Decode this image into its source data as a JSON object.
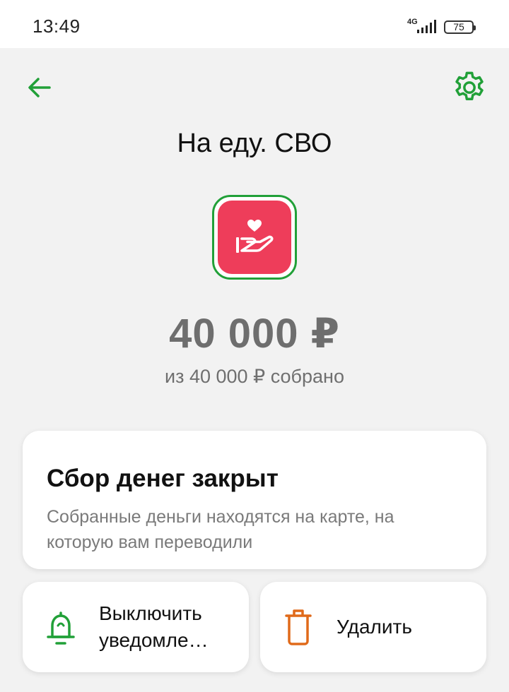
{
  "status_bar": {
    "time": "13:49",
    "network": "4G",
    "battery": "75"
  },
  "header": {
    "back_icon": "arrow-left-icon",
    "settings_icon": "gear-icon",
    "title": "На еду. СВО"
  },
  "goal": {
    "icon": "heart-in-hand-icon",
    "amount": "40 000 ₽",
    "progress_text": "из 40 000 ₽ собрано",
    "progress_fraction": 1.0
  },
  "status_card": {
    "title": "Сбор денег закрыт",
    "description": "Собранные деньги находятся на карте, на которую вам переводили"
  },
  "actions": {
    "notifications_label": "Выключить\nуведомле…",
    "notifications_icon": "bell-icon",
    "delete_label": "Удалить",
    "delete_icon": "trash-icon"
  },
  "colors": {
    "accent": "#21a038",
    "goal_icon_bg": "#ee3d5a",
    "delete_icon": "#e06a1a",
    "background": "#f2f2f2"
  }
}
